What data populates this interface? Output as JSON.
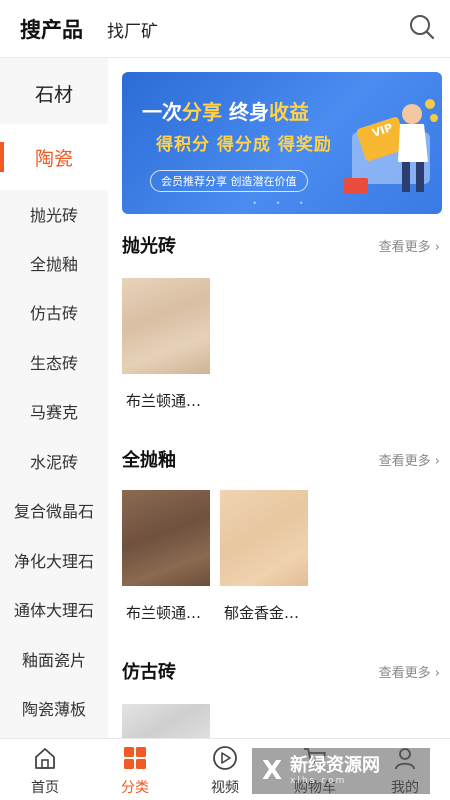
{
  "header": {
    "tab_products": "搜产品",
    "tab_factories": "找厂矿",
    "search_icon": "search-icon"
  },
  "sidebar": {
    "top_item": "石材",
    "active_item": "陶瓷",
    "items": [
      "抛光砖",
      "全抛釉",
      "仿古砖",
      "生态砖",
      "马赛克",
      "水泥砖",
      "复合微晶石",
      "净化大理石",
      "通体大理石",
      "釉面瓷片",
      "陶瓷薄板"
    ],
    "accent_color": "#f15a22"
  },
  "banner": {
    "line1_a": "一次",
    "line1_b": "分享",
    "line1_c": " 终身",
    "line1_d": "收益",
    "line2": "得积分  得分成  得奖励",
    "tagline": "会员推荐分享 创造潜在价值",
    "badge": "VIP",
    "dots": "• • •"
  },
  "sections": [
    {
      "title": "抛光砖",
      "more": "查看更多",
      "products": [
        {
          "label": "布兰顿通…"
        }
      ]
    },
    {
      "title": "全抛釉",
      "more": "查看更多",
      "products": [
        {
          "label": "布兰顿通…"
        },
        {
          "label": "郁金香金…"
        }
      ]
    },
    {
      "title": "仿古砖",
      "more": "查看更多",
      "products": []
    }
  ],
  "bottom_nav": {
    "items": [
      {
        "label": "首页",
        "icon": "home-icon"
      },
      {
        "label": "分类",
        "icon": "category-icon"
      },
      {
        "label": "视频",
        "icon": "play-icon"
      },
      {
        "label": "购物车",
        "icon": "cart-icon"
      },
      {
        "label": "我的",
        "icon": "user-icon"
      }
    ],
    "active_index": 1
  },
  "watermark": {
    "logo": "X",
    "title": "新绿资源网",
    "url": "xlhs.com"
  }
}
